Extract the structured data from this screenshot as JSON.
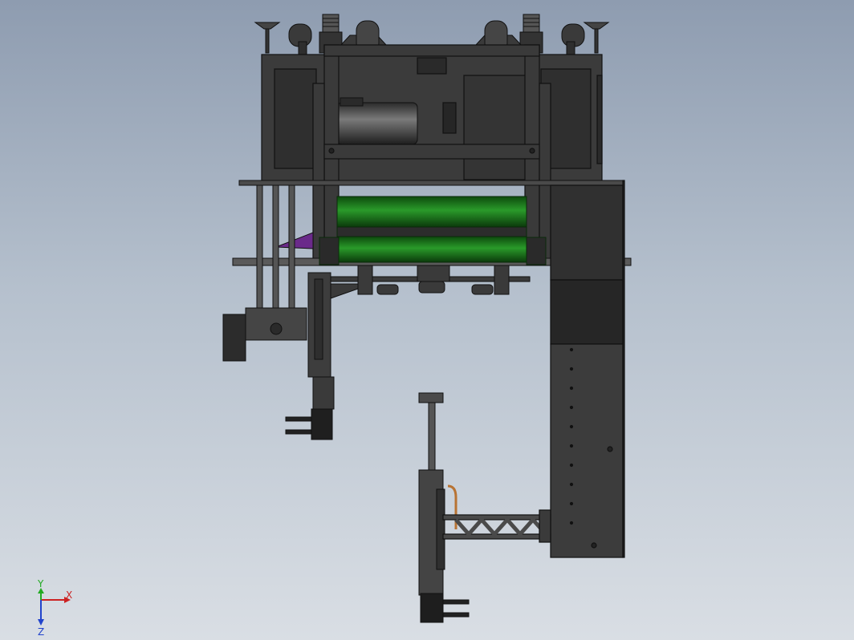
{
  "viewport": {
    "background_top": "#8e9cb0",
    "background_bottom": "#d9dee4"
  },
  "model": {
    "body_color": "#3a3a3a",
    "edge_color": "#111111",
    "roller_color": "#1f7a1f",
    "accent_color": "#6a2a8a",
    "copper_color": "#b87333"
  },
  "triad": {
    "x_label": "X",
    "y_label": "Y",
    "z_label": "Z",
    "x_color": "#cc2222",
    "y_color": "#22aa22",
    "z_color": "#2244cc"
  }
}
